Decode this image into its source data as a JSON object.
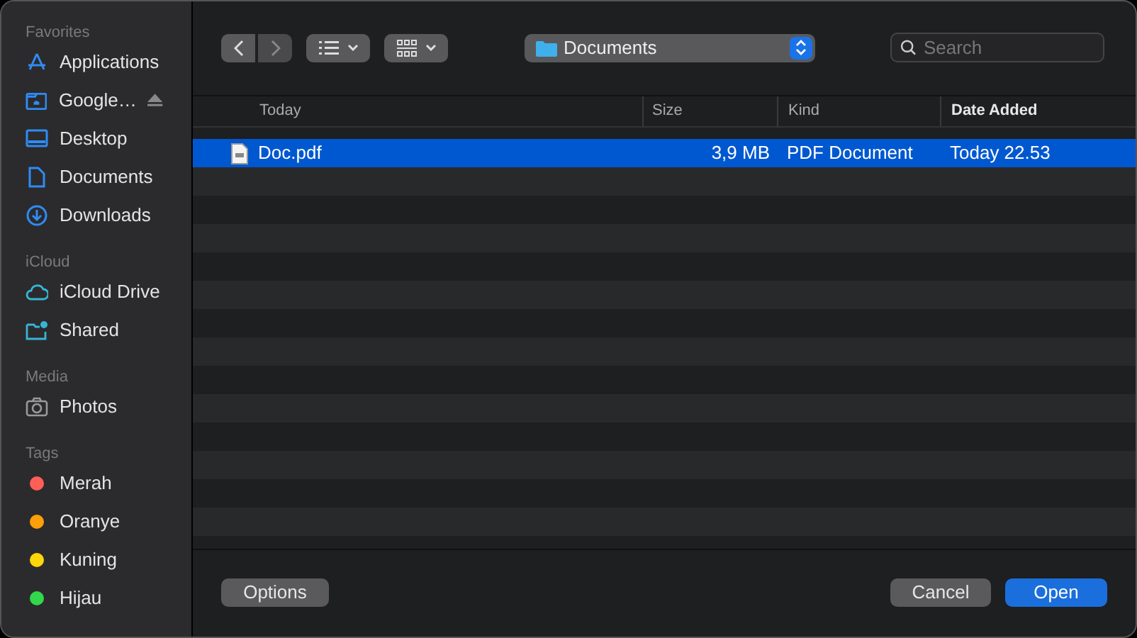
{
  "sidebar": {
    "sections": [
      {
        "title": "Favorites",
        "items": [
          {
            "label": "Applications",
            "kind": "apps"
          },
          {
            "label": "Google…",
            "kind": "drive",
            "eject": true
          },
          {
            "label": "Desktop",
            "kind": "desktop"
          },
          {
            "label": "Documents",
            "kind": "doc"
          },
          {
            "label": "Downloads",
            "kind": "download"
          }
        ]
      },
      {
        "title": "iCloud",
        "items": [
          {
            "label": "iCloud Drive",
            "kind": "cloud"
          },
          {
            "label": "Shared",
            "kind": "shared"
          }
        ]
      },
      {
        "title": "Media",
        "items": [
          {
            "label": "Photos",
            "kind": "camera"
          }
        ]
      },
      {
        "title": "Tags",
        "items": [
          {
            "label": "Merah",
            "kind": "tag",
            "color": "#ff5f57"
          },
          {
            "label": "Oranye",
            "kind": "tag",
            "color": "#ff9f0a"
          },
          {
            "label": "Kuning",
            "kind": "tag",
            "color": "#ffd60a"
          },
          {
            "label": "Hijau",
            "kind": "tag",
            "color": "#32d74b"
          }
        ]
      }
    ]
  },
  "toolbar": {
    "location": "Documents",
    "search": {
      "placeholder": "Search"
    }
  },
  "table": {
    "columns": [
      {
        "label": "Today",
        "sorted": false
      },
      {
        "label": "Size",
        "sorted": false
      },
      {
        "label": "Kind",
        "sorted": false
      },
      {
        "label": "Date Added",
        "sorted": true
      }
    ],
    "rows": [
      {
        "name": "Doc.pdf",
        "size": "3,9 MB",
        "kind": "PDF Document",
        "date": "Today 22.53",
        "selected": true
      }
    ]
  },
  "buttons": {
    "options": "Options",
    "cancel": "Cancel",
    "open": "Open"
  }
}
